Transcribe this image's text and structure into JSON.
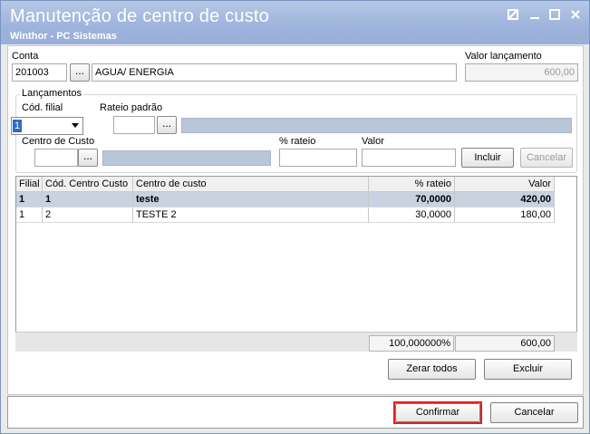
{
  "window": {
    "title": "Manutenção de centro de custo",
    "subtitle": "Winthor - PC Sistemas",
    "controls": [
      "restore-icon",
      "minimize-icon",
      "maximize-icon",
      "close-icon"
    ]
  },
  "conta": {
    "label": "Conta",
    "code": "201003",
    "lookup_label": "...",
    "description": "AGUA/ ENERGIA"
  },
  "valor_lancamento": {
    "label": "Valor lançamento",
    "value": "600,00"
  },
  "lancamentos": {
    "group_title": "Lançamentos",
    "cod_filial_label": "Cód. filial",
    "cod_filial_value": "1",
    "rateio_padrao_label": "Rateio padrão",
    "rateio_lookup_label": "...",
    "centro_custo_label": "Centro de Custo",
    "centro_lookup_label": "...",
    "perc_rateio_label": "% rateio",
    "valor_label": "Valor",
    "incluir_label": "Incluir",
    "cancelar_label": "Cancelar"
  },
  "grid": {
    "columns": [
      "Filial",
      "Cód. Centro Custo",
      "Centro de custo",
      "% rateio",
      "Valor"
    ],
    "rows": [
      [
        "1",
        "1",
        "teste",
        "70,0000",
        "420,00"
      ],
      [
        "1",
        "2",
        "TESTE 2",
        "30,0000",
        "180,00"
      ]
    ],
    "summary": {
      "perc_total": "100,000000%",
      "valor_total": "600,00"
    }
  },
  "actions": {
    "zerar_todos_label": "Zerar todos",
    "excluir_label": "Excluir",
    "confirmar_label": "Confirmar",
    "cancelar_label": "Cancelar"
  },
  "colors": {
    "titlebar": "#9db3dc",
    "selected_row": "#c8d2e0",
    "highlight_frame": "#e0201e"
  }
}
